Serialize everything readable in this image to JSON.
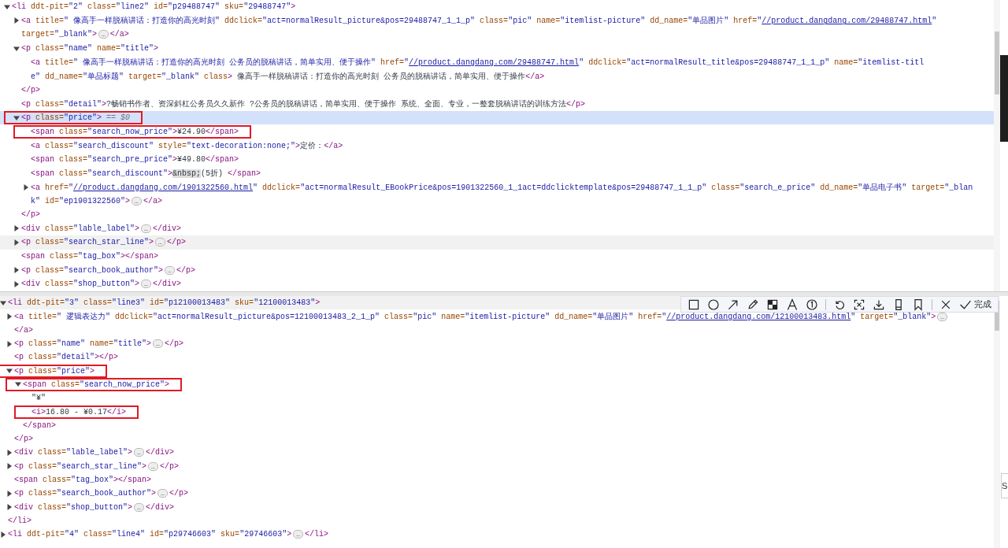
{
  "panels": [
    {
      "nodes": [
        {
          "kind": "element",
          "expanded": true,
          "selected": false,
          "open": [
            [
              {
                "kind": "tag",
                "text": "<li"
              },
              {
                "kind": "attr",
                "text": " ddt-pit="
              },
              {
                "kind": "value",
                "text": "\"2\""
              },
              {
                "kind": "attr",
                "text": " class="
              },
              {
                "kind": "value",
                "text": "\"line2\""
              },
              {
                "kind": "attr",
                "text": " id="
              },
              {
                "kind": "value",
                "text": "\"p29488747\""
              },
              {
                "kind": "attr",
                "text": " sku="
              },
              {
                "kind": "value",
                "text": "\"29488747\""
              },
              {
                "kind": "tag",
                "text": ">"
              }
            ]
          ],
          "children": [
            {
              "kind": "element",
              "expanded": false,
              "selected": false,
              "open": [
                [
                  {
                    "kind": "tag",
                    "text": "<a"
                  },
                  {
                    "kind": "attr",
                    "text": " title="
                  },
                  {
                    "kind": "value",
                    "text": "\" 像高手一样脱稿讲话：打造你的高光时刻\""
                  },
                  {
                    "kind": "attr",
                    "text": " ddclick="
                  },
                  {
                    "kind": "value",
                    "text": "\"act=normalResult_picture&pos=29488747_1_1_p\""
                  },
                  {
                    "kind": "attr",
                    "text": " class="
                  },
                  {
                    "kind": "value",
                    "text": "\"pic\""
                  },
                  {
                    "kind": "attr",
                    "text": " name="
                  },
                  {
                    "kind": "value",
                    "text": "\"itemlist-picture\""
                  },
                  {
                    "kind": "attr",
                    "text": " dd_name="
                  },
                  {
                    "kind": "value",
                    "text": "\"单品图片\""
                  },
                  {
                    "kind": "attr",
                    "text": " href="
                  },
                  {
                    "kind": "value",
                    "text": "\""
                  },
                  {
                    "kind": "link",
                    "text": "//product.dangdang.com/29488747.html"
                  },
                  {
                    "kind": "value",
                    "text": "\""
                  }
                ],
                [
                  {
                    "kind": "attr",
                    "text": "target="
                  },
                  {
                    "kind": "value",
                    "text": "\"_blank\""
                  },
                  {
                    "kind": "tag",
                    "text": ">"
                  },
                  {
                    "kind": "ellipsis",
                    "text": "…"
                  },
                  {
                    "kind": "tag",
                    "text": "</a>"
                  }
                ]
              ]
            },
            {
              "kind": "element",
              "expanded": true,
              "selected": false,
              "open": [
                [
                  {
                    "kind": "tag",
                    "text": "<p"
                  },
                  {
                    "kind": "attr",
                    "text": " class="
                  },
                  {
                    "kind": "value",
                    "text": "\"name\""
                  },
                  {
                    "kind": "attr",
                    "text": " name="
                  },
                  {
                    "kind": "value",
                    "text": "\"title\""
                  },
                  {
                    "kind": "tag",
                    "text": ">"
                  }
                ]
              ],
              "children": [
                {
                  "kind": "leaf",
                  "selected": false,
                  "open": [
                    [
                      {
                        "kind": "tag",
                        "text": "<a"
                      },
                      {
                        "kind": "attr",
                        "text": " title="
                      },
                      {
                        "kind": "value",
                        "text": "\" 像高手一样脱稿讲话：打造你的高光时刻 公务员的脱稿讲话，简单实用、便于操作\""
                      },
                      {
                        "kind": "attr",
                        "text": " href="
                      },
                      {
                        "kind": "value",
                        "text": "\""
                      },
                      {
                        "kind": "link",
                        "text": "//product.dangdang.com/29488747.html"
                      },
                      {
                        "kind": "value",
                        "text": "\""
                      },
                      {
                        "kind": "attr",
                        "text": " ddclick="
                      },
                      {
                        "kind": "value",
                        "text": "\"act=normalResult_title&pos=29488747_1_1_p\""
                      },
                      {
                        "kind": "attr",
                        "text": " name="
                      },
                      {
                        "kind": "value",
                        "text": "\"itemlist-titl"
                      }
                    ],
                    [
                      {
                        "kind": "value",
                        "text": "e\""
                      },
                      {
                        "kind": "attr",
                        "text": " dd_name="
                      },
                      {
                        "kind": "value",
                        "text": "\"单品标题\""
                      },
                      {
                        "kind": "attr",
                        "text": " target="
                      },
                      {
                        "kind": "value",
                        "text": "\"_blank\""
                      },
                      {
                        "kind": "attr",
                        "text": " class"
                      },
                      {
                        "kind": "tag",
                        "text": ">"
                      },
                      {
                        "kind": "text",
                        "text": " 像高手一样脱稿讲话：打造你的高光时刻 公务员的脱稿讲话，简单实用、便于操作"
                      },
                      {
                        "kind": "tag",
                        "text": "</a>"
                      }
                    ]
                  ]
                }
              ],
              "close": [
                {
                  "kind": "tag",
                  "text": "</p>"
                }
              ]
            },
            {
              "kind": "leaf",
              "selected": false,
              "open": [
                [
                  {
                    "kind": "tag",
                    "text": "<p"
                  },
                  {
                    "kind": "attr",
                    "text": " class="
                  },
                  {
                    "kind": "value",
                    "text": "\"detail\""
                  },
                  {
                    "kind": "tag",
                    "text": ">"
                  },
                  {
                    "kind": "text",
                    "text": "?畅销书作者、资深斜杠公务员久久新作 ?公务员的脱稿讲话，简单实用、便于操作 系统、全面、专业，一整套脱稿讲话的训练方法"
                  },
                  {
                    "kind": "tag",
                    "text": "</p>"
                  }
                ]
              ]
            },
            {
              "kind": "element",
              "expanded": true,
              "selected": true,
              "marked": true,
              "open": [
                [
                  {
                    "kind": "tag",
                    "text": "<p"
                  },
                  {
                    "kind": "attr",
                    "text": " class="
                  },
                  {
                    "kind": "value",
                    "text": "\"price\""
                  },
                  {
                    "kind": "tag",
                    "text": ">"
                  },
                  {
                    "kind": "console",
                    "text": " == $0"
                  }
                ]
              ],
              "children": [
                {
                  "kind": "leaf",
                  "selected": false,
                  "marked": true,
                  "open": [
                    [
                      {
                        "kind": "tag",
                        "text": "<span"
                      },
                      {
                        "kind": "attr",
                        "text": " class="
                      },
                      {
                        "kind": "value",
                        "text": "\"search_now_price\""
                      },
                      {
                        "kind": "tag",
                        "text": ">"
                      },
                      {
                        "kind": "text",
                        "text": "¥24.90"
                      },
                      {
                        "kind": "tag",
                        "text": "</span>"
                      }
                    ]
                  ]
                },
                {
                  "kind": "leaf",
                  "selected": false,
                  "open": [
                    [
                      {
                        "kind": "tag",
                        "text": "<a"
                      },
                      {
                        "kind": "attr",
                        "text": " class="
                      },
                      {
                        "kind": "value",
                        "text": "\"search_discount\""
                      },
                      {
                        "kind": "attr",
                        "text": " style="
                      },
                      {
                        "kind": "value",
                        "text": "\"text-decoration:none;\""
                      },
                      {
                        "kind": "tag",
                        "text": ">"
                      },
                      {
                        "kind": "text",
                        "text": "定价："
                      },
                      {
                        "kind": "tag",
                        "text": "</a>"
                      }
                    ]
                  ]
                },
                {
                  "kind": "leaf",
                  "selected": false,
                  "open": [
                    [
                      {
                        "kind": "tag",
                        "text": "<span"
                      },
                      {
                        "kind": "attr",
                        "text": " class="
                      },
                      {
                        "kind": "value",
                        "text": "\"search_pre_price\""
                      },
                      {
                        "kind": "tag",
                        "text": ">"
                      },
                      {
                        "kind": "text",
                        "text": "¥49.80"
                      },
                      {
                        "kind": "tag",
                        "text": "</span>"
                      }
                    ]
                  ]
                },
                {
                  "kind": "leaf",
                  "selected": false,
                  "open": [
                    [
                      {
                        "kind": "tag",
                        "text": "<span"
                      },
                      {
                        "kind": "attr",
                        "text": " class="
                      },
                      {
                        "kind": "value",
                        "text": "\"search_discount\""
                      },
                      {
                        "kind": "tag",
                        "text": ">"
                      },
                      {
                        "kind": "entity",
                        "text": "&nbsp;"
                      },
                      {
                        "kind": "text",
                        "text": "(5折) "
                      },
                      {
                        "kind": "tag",
                        "text": "</span>"
                      }
                    ]
                  ]
                },
                {
                  "kind": "element",
                  "expanded": false,
                  "selected": false,
                  "open": [
                    [
                      {
                        "kind": "tag",
                        "text": "<a"
                      },
                      {
                        "kind": "attr",
                        "text": " href="
                      },
                      {
                        "kind": "value",
                        "text": "\""
                      },
                      {
                        "kind": "link",
                        "text": "//product.dangdang.com/1901322560.html"
                      },
                      {
                        "kind": "value",
                        "text": "\""
                      },
                      {
                        "kind": "attr",
                        "text": " ddclick="
                      },
                      {
                        "kind": "value",
                        "text": "\"act=normalResult_EBookPrice&pos=1901322560_1_1act=ddclicktemplate&pos=29488747_1_1_p\""
                      },
                      {
                        "kind": "attr",
                        "text": " class="
                      },
                      {
                        "kind": "value",
                        "text": "\"search_e_price\""
                      },
                      {
                        "kind": "attr",
                        "text": " dd_name="
                      },
                      {
                        "kind": "value",
                        "text": "\"单品电子书\""
                      },
                      {
                        "kind": "attr",
                        "text": " target="
                      },
                      {
                        "kind": "value",
                        "text": "\"_blan"
                      }
                    ],
                    [
                      {
                        "kind": "value",
                        "text": "k\""
                      },
                      {
                        "kind": "attr",
                        "text": " id="
                      },
                      {
                        "kind": "value",
                        "text": "\"ep1901322560\""
                      },
                      {
                        "kind": "tag",
                        "text": ">"
                      },
                      {
                        "kind": "ellipsis",
                        "text": "…"
                      },
                      {
                        "kind": "tag",
                        "text": "</a>"
                      }
                    ]
                  ]
                }
              ],
              "close": [
                {
                  "kind": "tag",
                  "text": "</p>"
                }
              ]
            },
            {
              "kind": "element",
              "expanded": false,
              "selected": false,
              "open": [
                [
                  {
                    "kind": "tag",
                    "text": "<div"
                  },
                  {
                    "kind": "attr",
                    "text": " class="
                  },
                  {
                    "kind": "value",
                    "text": "\"lable_label\""
                  },
                  {
                    "kind": "tag",
                    "text": ">"
                  },
                  {
                    "kind": "ellipsis",
                    "text": "…"
                  },
                  {
                    "kind": "tag",
                    "text": "</div>"
                  }
                ]
              ]
            },
            {
              "kind": "element",
              "expanded": false,
              "selected": false,
              "hovered": true,
              "open": [
                [
                  {
                    "kind": "tag",
                    "text": "<p"
                  },
                  {
                    "kind": "attr",
                    "text": " class="
                  },
                  {
                    "kind": "value",
                    "text": "\"search_star_line\""
                  },
                  {
                    "kind": "tag",
                    "text": ">"
                  },
                  {
                    "kind": "ellipsis",
                    "text": "…"
                  },
                  {
                    "kind": "tag",
                    "text": "</p>"
                  }
                ]
              ]
            },
            {
              "kind": "leaf",
              "selected": false,
              "open": [
                [
                  {
                    "kind": "tag",
                    "text": "<span"
                  },
                  {
                    "kind": "attr",
                    "text": " class="
                  },
                  {
                    "kind": "value",
                    "text": "\"tag_box\""
                  },
                  {
                    "kind": "tag",
                    "text": "></span>"
                  }
                ]
              ]
            },
            {
              "kind": "element",
              "expanded": false,
              "selected": false,
              "open": [
                [
                  {
                    "kind": "tag",
                    "text": "<p"
                  },
                  {
                    "kind": "attr",
                    "text": " class="
                  },
                  {
                    "kind": "value",
                    "text": "\"search_book_author\""
                  },
                  {
                    "kind": "tag",
                    "text": ">"
                  },
                  {
                    "kind": "ellipsis",
                    "text": "…"
                  },
                  {
                    "kind": "tag",
                    "text": "</p>"
                  }
                ]
              ]
            },
            {
              "kind": "element",
              "expanded": false,
              "selected": false,
              "open": [
                [
                  {
                    "kind": "tag",
                    "text": "<div"
                  },
                  {
                    "kind": "attr",
                    "text": " class="
                  },
                  {
                    "kind": "value",
                    "text": "\"shop_button\""
                  },
                  {
                    "kind": "tag",
                    "text": ">"
                  },
                  {
                    "kind": "ellipsis",
                    "text": "…"
                  },
                  {
                    "kind": "tag",
                    "text": "</div>"
                  }
                ]
              ]
            }
          ]
        }
      ]
    },
    {
      "nodes": [
        {
          "kind": "element",
          "expanded": true,
          "selected": false,
          "hovered": true,
          "open": [
            [
              {
                "kind": "tag",
                "text": "<li"
              },
              {
                "kind": "attr",
                "text": " ddt-pit="
              },
              {
                "kind": "value",
                "text": "\"3\""
              },
              {
                "kind": "attr",
                "text": " class="
              },
              {
                "kind": "value",
                "text": "\"line3\""
              },
              {
                "kind": "attr",
                "text": " id="
              },
              {
                "kind": "value",
                "text": "\"p12100013483\""
              },
              {
                "kind": "attr",
                "text": " sku="
              },
              {
                "kind": "value",
                "text": "\"12100013483\""
              },
              {
                "kind": "tag",
                "text": ">"
              }
            ]
          ],
          "children": [
            {
              "kind": "element",
              "expanded": false,
              "selected": false,
              "open": [
                [
                  {
                    "kind": "tag",
                    "text": "<a"
                  },
                  {
                    "kind": "attr",
                    "text": " title="
                  },
                  {
                    "kind": "value",
                    "text": "\" 逻辑表达力\""
                  },
                  {
                    "kind": "attr",
                    "text": " ddclick="
                  },
                  {
                    "kind": "value",
                    "text": "\"act=normalResult_picture&pos=12100013483_2_1_p\""
                  },
                  {
                    "kind": "attr",
                    "text": " class="
                  },
                  {
                    "kind": "value",
                    "text": "\"pic\""
                  },
                  {
                    "kind": "attr",
                    "text": " name="
                  },
                  {
                    "kind": "value",
                    "text": "\"itemlist-picture\""
                  },
                  {
                    "kind": "attr",
                    "text": " dd_name="
                  },
                  {
                    "kind": "value",
                    "text": "\"单品图片\""
                  },
                  {
                    "kind": "attr",
                    "text": " href="
                  },
                  {
                    "kind": "value",
                    "text": "\""
                  },
                  {
                    "kind": "link",
                    "text": "//product.dangdang.com/12100013483.html"
                  },
                  {
                    "kind": "value",
                    "text": "\""
                  },
                  {
                    "kind": "attr",
                    "text": " target="
                  },
                  {
                    "kind": "value",
                    "text": "\"_blank\""
                  },
                  {
                    "kind": "tag",
                    "text": ">"
                  },
                  {
                    "kind": "ellipsis",
                    "text": "…"
                  }
                ],
                [
                  {
                    "kind": "tag",
                    "text": "</a>"
                  }
                ]
              ]
            },
            {
              "kind": "element",
              "expanded": false,
              "selected": false,
              "open": [
                [
                  {
                    "kind": "tag",
                    "text": "<p"
                  },
                  {
                    "kind": "attr",
                    "text": " class="
                  },
                  {
                    "kind": "value",
                    "text": "\"name\""
                  },
                  {
                    "kind": "attr",
                    "text": " name="
                  },
                  {
                    "kind": "value",
                    "text": "\"title\""
                  },
                  {
                    "kind": "tag",
                    "text": ">"
                  },
                  {
                    "kind": "ellipsis",
                    "text": "…"
                  },
                  {
                    "kind": "tag",
                    "text": "</p>"
                  }
                ]
              ]
            },
            {
              "kind": "leaf",
              "selected": false,
              "open": [
                [
                  {
                    "kind": "tag",
                    "text": "<p"
                  },
                  {
                    "kind": "attr",
                    "text": " class="
                  },
                  {
                    "kind": "value",
                    "text": "\"detail\""
                  },
                  {
                    "kind": "tag",
                    "text": "></p>"
                  }
                ]
              ]
            },
            {
              "kind": "element",
              "expanded": true,
              "selected": false,
              "marked": true,
              "open": [
                [
                  {
                    "kind": "tag",
                    "text": "<p"
                  },
                  {
                    "kind": "attr",
                    "text": " class="
                  },
                  {
                    "kind": "value",
                    "text": "\"price\""
                  },
                  {
                    "kind": "tag",
                    "text": ">"
                  }
                ]
              ],
              "children": [
                {
                  "kind": "element",
                  "expanded": true,
                  "selected": false,
                  "marked": true,
                  "open": [
                    [
                      {
                        "kind": "tag",
                        "text": "<span"
                      },
                      {
                        "kind": "attr",
                        "text": " class="
                      },
                      {
                        "kind": "value",
                        "text": "\"search_now_price\""
                      },
                      {
                        "kind": "tag",
                        "text": ">"
                      }
                    ]
                  ],
                  "children": [
                    {
                      "kind": "leaf",
                      "selected": false,
                      "open": [
                        [
                          {
                            "kind": "text",
                            "text": "\"¥\""
                          }
                        ]
                      ]
                    },
                    {
                      "kind": "leaf",
                      "selected": false,
                      "marked": true,
                      "open": [
                        [
                          {
                            "kind": "tag",
                            "text": "<i>"
                          },
                          {
                            "kind": "text",
                            "text": "16.80 - ¥0.17"
                          },
                          {
                            "kind": "tag",
                            "text": "</i>"
                          }
                        ]
                      ]
                    }
                  ],
                  "close": [
                    {
                      "kind": "tag",
                      "text": "</span>"
                    }
                  ]
                }
              ],
              "close": [
                {
                  "kind": "tag",
                  "text": "</p>"
                }
              ]
            },
            {
              "kind": "element",
              "expanded": false,
              "selected": false,
              "open": [
                [
                  {
                    "kind": "tag",
                    "text": "<div"
                  },
                  {
                    "kind": "attr",
                    "text": " class="
                  },
                  {
                    "kind": "value",
                    "text": "\"lable_label\""
                  },
                  {
                    "kind": "tag",
                    "text": ">"
                  },
                  {
                    "kind": "ellipsis",
                    "text": "…"
                  },
                  {
                    "kind": "tag",
                    "text": "</div>"
                  }
                ]
              ]
            },
            {
              "kind": "element",
              "expanded": false,
              "selected": false,
              "open": [
                [
                  {
                    "kind": "tag",
                    "text": "<p"
                  },
                  {
                    "kind": "attr",
                    "text": " class="
                  },
                  {
                    "kind": "value",
                    "text": "\"search_star_line\""
                  },
                  {
                    "kind": "tag",
                    "text": ">"
                  },
                  {
                    "kind": "ellipsis",
                    "text": "…"
                  },
                  {
                    "kind": "tag",
                    "text": "</p>"
                  }
                ]
              ]
            },
            {
              "kind": "leaf",
              "selected": false,
              "open": [
                [
                  {
                    "kind": "tag",
                    "text": "<span"
                  },
                  {
                    "kind": "attr",
                    "text": " class="
                  },
                  {
                    "kind": "value",
                    "text": "\"tag_box\""
                  },
                  {
                    "kind": "tag",
                    "text": "></span>"
                  }
                ]
              ]
            },
            {
              "kind": "element",
              "expanded": false,
              "selected": false,
              "open": [
                [
                  {
                    "kind": "tag",
                    "text": "<p"
                  },
                  {
                    "kind": "attr",
                    "text": " class="
                  },
                  {
                    "kind": "value",
                    "text": "\"search_book_author\""
                  },
                  {
                    "kind": "tag",
                    "text": ">"
                  },
                  {
                    "kind": "ellipsis",
                    "text": "…"
                  },
                  {
                    "kind": "tag",
                    "text": "</p>"
                  }
                ]
              ]
            },
            {
              "kind": "element",
              "expanded": false,
              "selected": false,
              "open": [
                [
                  {
                    "kind": "tag",
                    "text": "<div"
                  },
                  {
                    "kind": "attr",
                    "text": " class="
                  },
                  {
                    "kind": "value",
                    "text": "\"shop_button\""
                  },
                  {
                    "kind": "tag",
                    "text": ">"
                  },
                  {
                    "kind": "ellipsis",
                    "text": "…"
                  },
                  {
                    "kind": "tag",
                    "text": "</div>"
                  }
                ]
              ]
            }
          ],
          "close": [
            {
              "kind": "tag",
              "text": "</li>"
            }
          ]
        },
        {
          "kind": "element",
          "expanded": false,
          "selected": false,
          "open": [
            [
              {
                "kind": "tag",
                "text": "<li"
              },
              {
                "kind": "attr",
                "text": " ddt-pit="
              },
              {
                "kind": "value",
                "text": "\"4\""
              },
              {
                "kind": "attr",
                "text": " class="
              },
              {
                "kind": "value",
                "text": "\"line4\""
              },
              {
                "kind": "attr",
                "text": " id="
              },
              {
                "kind": "value",
                "text": "\"p29746603\""
              },
              {
                "kind": "attr",
                "text": " sku="
              },
              {
                "kind": "value",
                "text": "\"29746603\""
              },
              {
                "kind": "tag",
                "text": ">"
              },
              {
                "kind": "ellipsis",
                "text": "…"
              },
              {
                "kind": "tag",
                "text": "</li>"
              }
            ]
          ]
        }
      ]
    }
  ],
  "toolbar": {
    "tools": [
      {
        "kind": "rectangle"
      },
      {
        "kind": "circle"
      },
      {
        "kind": "arrow"
      },
      {
        "kind": "pencil"
      },
      {
        "kind": "mosaic"
      },
      {
        "kind": "text"
      },
      {
        "kind": "number"
      },
      {
        "kind": "separator"
      },
      {
        "kind": "undo"
      },
      {
        "kind": "ocr"
      },
      {
        "kind": "download"
      },
      {
        "kind": "phone"
      },
      {
        "kind": "bookmark"
      },
      {
        "kind": "separator"
      },
      {
        "kind": "close"
      }
    ],
    "done_label": "完成"
  },
  "side_tab": "S"
}
